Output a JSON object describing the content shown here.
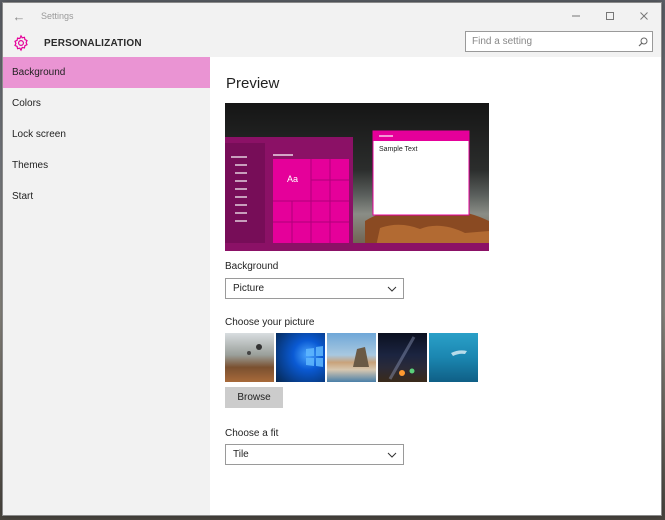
{
  "window": {
    "title": "Settings"
  },
  "header": {
    "app_title": "PERSONALIZATION",
    "accent": "#e5009a"
  },
  "search": {
    "placeholder": "Find a setting"
  },
  "sidebar": {
    "active_color": "#ea94d3",
    "items": [
      {
        "label": "Background",
        "active": true
      },
      {
        "label": "Colors",
        "active": false
      },
      {
        "label": "Lock screen",
        "active": false
      },
      {
        "label": "Themes",
        "active": false
      },
      {
        "label": "Start",
        "active": false
      }
    ]
  },
  "main": {
    "preview_title": "Preview",
    "preview": {
      "tile_text": "Aa",
      "window_text": "Sample Text"
    },
    "background": {
      "label": "Background",
      "selected": "Picture"
    },
    "choose_picture": {
      "label": "Choose your picture",
      "thumbnails": [
        "desert-balloons",
        "windows-blue",
        "beach-rock",
        "night-sky",
        "underwater-swimmer"
      ]
    },
    "browse_label": "Browse",
    "fit": {
      "label": "Choose a fit",
      "selected": "Tile"
    }
  },
  "icons": {
    "back": "back-arrow-icon",
    "minimize": "minimize-icon",
    "maximize": "maximize-icon",
    "close": "close-icon",
    "gear": "gear-icon",
    "search": "search-icon",
    "chevron": "chevron-down-icon"
  }
}
